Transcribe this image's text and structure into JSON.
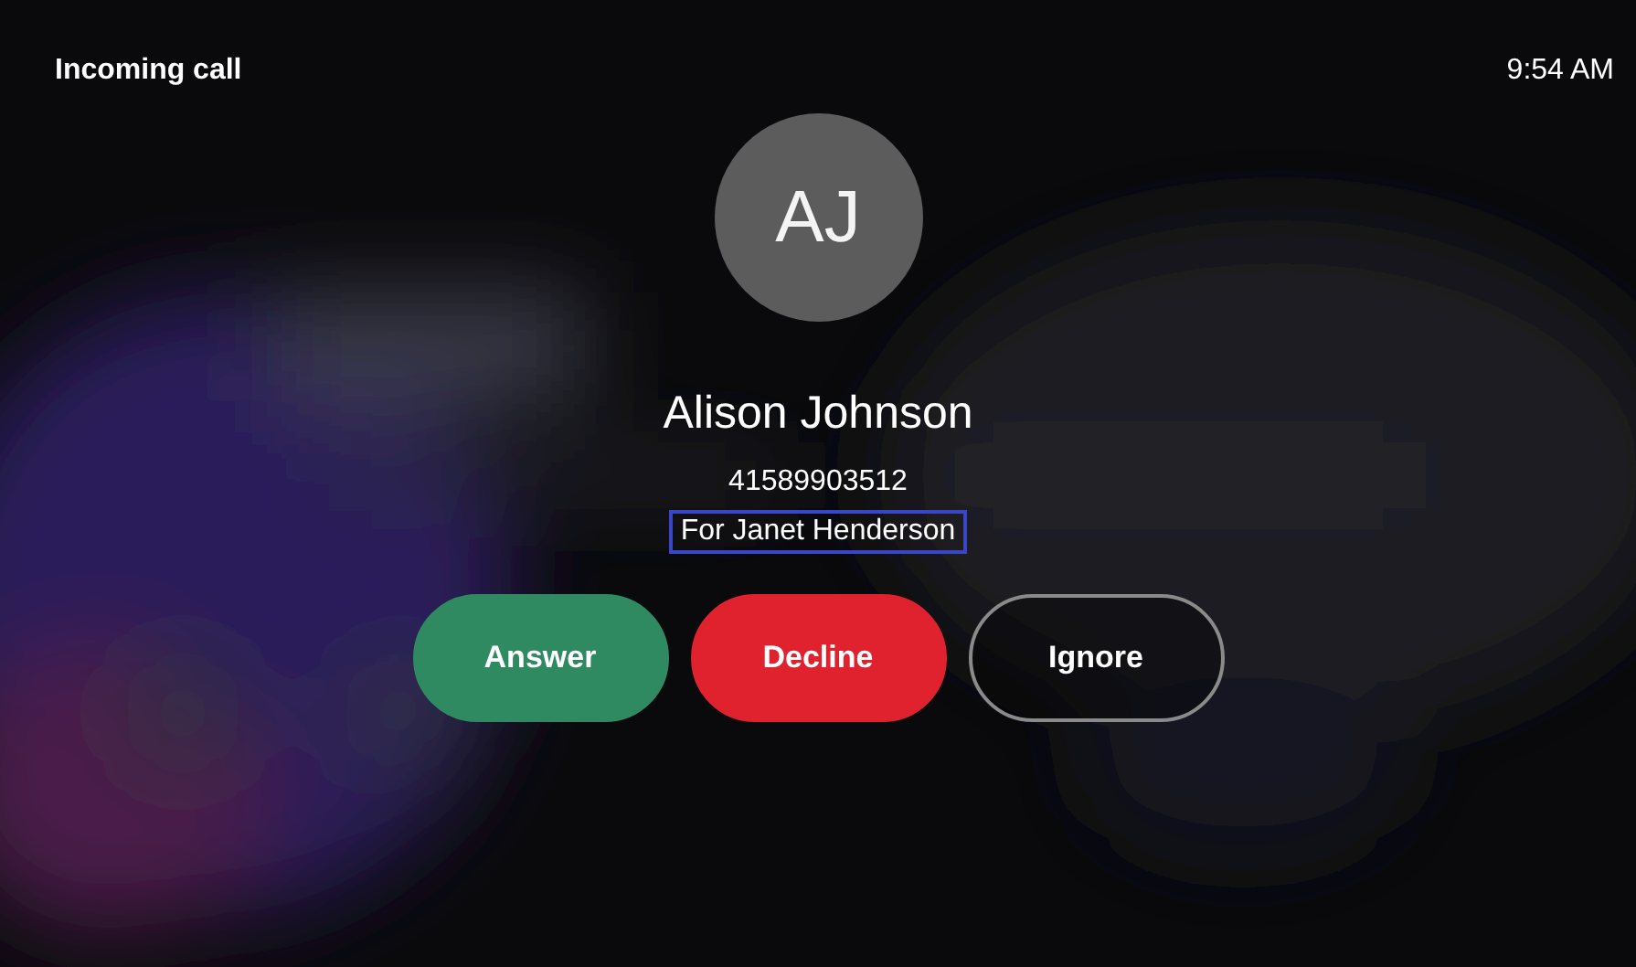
{
  "header": {
    "title": "Incoming call",
    "time": "9:54 AM"
  },
  "caller": {
    "initials": "AJ",
    "name": "Alison Johnson",
    "number": "41589903512",
    "note": "For Janet Henderson",
    "note_focused": true
  },
  "actions": [
    {
      "label": "Answer",
      "kind": "answer"
    },
    {
      "label": "Decline",
      "kind": "decline"
    },
    {
      "label": "Ignore",
      "kind": "ignore"
    }
  ]
}
